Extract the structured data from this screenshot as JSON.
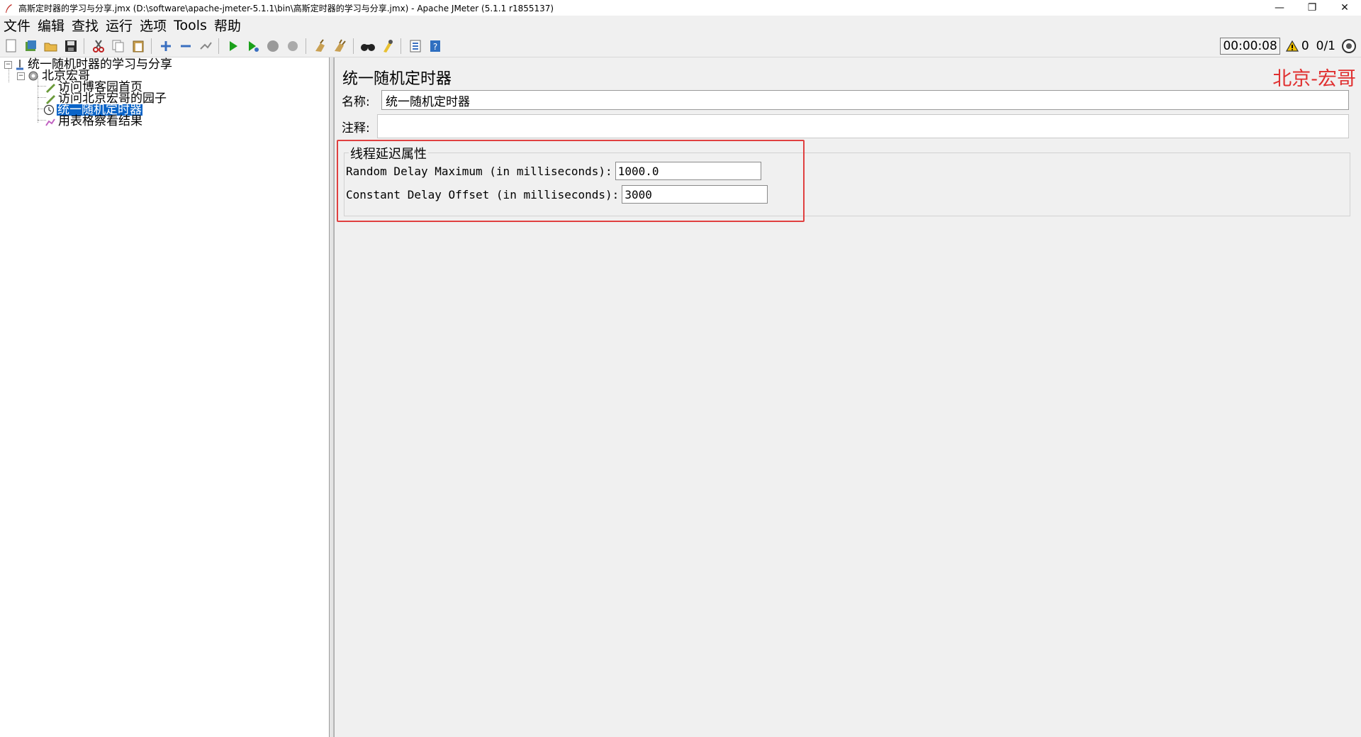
{
  "window": {
    "title": "高斯定时器的学习与分享.jmx (D:\\software\\apache-jmeter-5.1.1\\bin\\高斯定时器的学习与分享.jmx) - Apache JMeter (5.1.1 r1855137)",
    "minimize": "—",
    "restore": "❐",
    "close": "✕"
  },
  "menu": {
    "items": [
      "文件",
      "编辑",
      "查找",
      "运行",
      "选项",
      "Tools",
      "帮助"
    ]
  },
  "toolbar": {
    "timer": "00:00:08",
    "warning_count": "0",
    "threads": "0/1"
  },
  "tree": {
    "root": "统一随机时器的学习与分享",
    "thread_group": "北京宏哥",
    "children": [
      "访问博客园首页",
      "访问北京宏哥的园子",
      "统一随机定时器",
      "用表格察看结果"
    ]
  },
  "panel": {
    "title": "统一随机定时器",
    "watermark": "北京-宏哥",
    "name_label": "名称:",
    "name_value": "统一随机定时器",
    "comment_label": "注释:",
    "group_title": "线程延迟属性",
    "random_delay_label": "Random Delay Maximum (in milliseconds):",
    "random_delay_value": "1000.0",
    "constant_delay_label": "Constant Delay Offset (in milliseconds):",
    "constant_delay_value": "3000"
  },
  "colors": {
    "selection": "#0a64c8",
    "highlight": "#e04040",
    "watermark": "#e03030"
  }
}
